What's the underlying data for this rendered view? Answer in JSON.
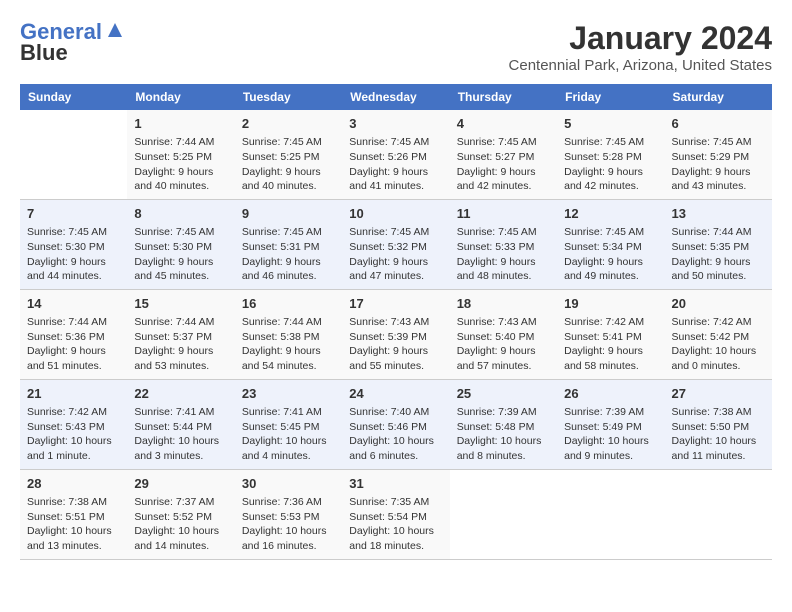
{
  "logo": {
    "line1": "General",
    "line2": "Blue"
  },
  "title": "January 2024",
  "subtitle": "Centennial Park, Arizona, United States",
  "days_of_week": [
    "Sunday",
    "Monday",
    "Tuesday",
    "Wednesday",
    "Thursday",
    "Friday",
    "Saturday"
  ],
  "weeks": [
    [
      {
        "day": "",
        "sunrise": "",
        "sunset": "",
        "daylight": ""
      },
      {
        "day": "1",
        "sunrise": "Sunrise: 7:44 AM",
        "sunset": "Sunset: 5:25 PM",
        "daylight": "Daylight: 9 hours and 40 minutes."
      },
      {
        "day": "2",
        "sunrise": "Sunrise: 7:45 AM",
        "sunset": "Sunset: 5:25 PM",
        "daylight": "Daylight: 9 hours and 40 minutes."
      },
      {
        "day": "3",
        "sunrise": "Sunrise: 7:45 AM",
        "sunset": "Sunset: 5:26 PM",
        "daylight": "Daylight: 9 hours and 41 minutes."
      },
      {
        "day": "4",
        "sunrise": "Sunrise: 7:45 AM",
        "sunset": "Sunset: 5:27 PM",
        "daylight": "Daylight: 9 hours and 42 minutes."
      },
      {
        "day": "5",
        "sunrise": "Sunrise: 7:45 AM",
        "sunset": "Sunset: 5:28 PM",
        "daylight": "Daylight: 9 hours and 42 minutes."
      },
      {
        "day": "6",
        "sunrise": "Sunrise: 7:45 AM",
        "sunset": "Sunset: 5:29 PM",
        "daylight": "Daylight: 9 hours and 43 minutes."
      }
    ],
    [
      {
        "day": "7",
        "sunrise": "Sunrise: 7:45 AM",
        "sunset": "Sunset: 5:30 PM",
        "daylight": "Daylight: 9 hours and 44 minutes."
      },
      {
        "day": "8",
        "sunrise": "Sunrise: 7:45 AM",
        "sunset": "Sunset: 5:30 PM",
        "daylight": "Daylight: 9 hours and 45 minutes."
      },
      {
        "day": "9",
        "sunrise": "Sunrise: 7:45 AM",
        "sunset": "Sunset: 5:31 PM",
        "daylight": "Daylight: 9 hours and 46 minutes."
      },
      {
        "day": "10",
        "sunrise": "Sunrise: 7:45 AM",
        "sunset": "Sunset: 5:32 PM",
        "daylight": "Daylight: 9 hours and 47 minutes."
      },
      {
        "day": "11",
        "sunrise": "Sunrise: 7:45 AM",
        "sunset": "Sunset: 5:33 PM",
        "daylight": "Daylight: 9 hours and 48 minutes."
      },
      {
        "day": "12",
        "sunrise": "Sunrise: 7:45 AM",
        "sunset": "Sunset: 5:34 PM",
        "daylight": "Daylight: 9 hours and 49 minutes."
      },
      {
        "day": "13",
        "sunrise": "Sunrise: 7:44 AM",
        "sunset": "Sunset: 5:35 PM",
        "daylight": "Daylight: 9 hours and 50 minutes."
      }
    ],
    [
      {
        "day": "14",
        "sunrise": "Sunrise: 7:44 AM",
        "sunset": "Sunset: 5:36 PM",
        "daylight": "Daylight: 9 hours and 51 minutes."
      },
      {
        "day": "15",
        "sunrise": "Sunrise: 7:44 AM",
        "sunset": "Sunset: 5:37 PM",
        "daylight": "Daylight: 9 hours and 53 minutes."
      },
      {
        "day": "16",
        "sunrise": "Sunrise: 7:44 AM",
        "sunset": "Sunset: 5:38 PM",
        "daylight": "Daylight: 9 hours and 54 minutes."
      },
      {
        "day": "17",
        "sunrise": "Sunrise: 7:43 AM",
        "sunset": "Sunset: 5:39 PM",
        "daylight": "Daylight: 9 hours and 55 minutes."
      },
      {
        "day": "18",
        "sunrise": "Sunrise: 7:43 AM",
        "sunset": "Sunset: 5:40 PM",
        "daylight": "Daylight: 9 hours and 57 minutes."
      },
      {
        "day": "19",
        "sunrise": "Sunrise: 7:42 AM",
        "sunset": "Sunset: 5:41 PM",
        "daylight": "Daylight: 9 hours and 58 minutes."
      },
      {
        "day": "20",
        "sunrise": "Sunrise: 7:42 AM",
        "sunset": "Sunset: 5:42 PM",
        "daylight": "Daylight: 10 hours and 0 minutes."
      }
    ],
    [
      {
        "day": "21",
        "sunrise": "Sunrise: 7:42 AM",
        "sunset": "Sunset: 5:43 PM",
        "daylight": "Daylight: 10 hours and 1 minute."
      },
      {
        "day": "22",
        "sunrise": "Sunrise: 7:41 AM",
        "sunset": "Sunset: 5:44 PM",
        "daylight": "Daylight: 10 hours and 3 minutes."
      },
      {
        "day": "23",
        "sunrise": "Sunrise: 7:41 AM",
        "sunset": "Sunset: 5:45 PM",
        "daylight": "Daylight: 10 hours and 4 minutes."
      },
      {
        "day": "24",
        "sunrise": "Sunrise: 7:40 AM",
        "sunset": "Sunset: 5:46 PM",
        "daylight": "Daylight: 10 hours and 6 minutes."
      },
      {
        "day": "25",
        "sunrise": "Sunrise: 7:39 AM",
        "sunset": "Sunset: 5:48 PM",
        "daylight": "Daylight: 10 hours and 8 minutes."
      },
      {
        "day": "26",
        "sunrise": "Sunrise: 7:39 AM",
        "sunset": "Sunset: 5:49 PM",
        "daylight": "Daylight: 10 hours and 9 minutes."
      },
      {
        "day": "27",
        "sunrise": "Sunrise: 7:38 AM",
        "sunset": "Sunset: 5:50 PM",
        "daylight": "Daylight: 10 hours and 11 minutes."
      }
    ],
    [
      {
        "day": "28",
        "sunrise": "Sunrise: 7:38 AM",
        "sunset": "Sunset: 5:51 PM",
        "daylight": "Daylight: 10 hours and 13 minutes."
      },
      {
        "day": "29",
        "sunrise": "Sunrise: 7:37 AM",
        "sunset": "Sunset: 5:52 PM",
        "daylight": "Daylight: 10 hours and 14 minutes."
      },
      {
        "day": "30",
        "sunrise": "Sunrise: 7:36 AM",
        "sunset": "Sunset: 5:53 PM",
        "daylight": "Daylight: 10 hours and 16 minutes."
      },
      {
        "day": "31",
        "sunrise": "Sunrise: 7:35 AM",
        "sunset": "Sunset: 5:54 PM",
        "daylight": "Daylight: 10 hours and 18 minutes."
      },
      {
        "day": "",
        "sunrise": "",
        "sunset": "",
        "daylight": ""
      },
      {
        "day": "",
        "sunrise": "",
        "sunset": "",
        "daylight": ""
      },
      {
        "day": "",
        "sunrise": "",
        "sunset": "",
        "daylight": ""
      }
    ]
  ]
}
